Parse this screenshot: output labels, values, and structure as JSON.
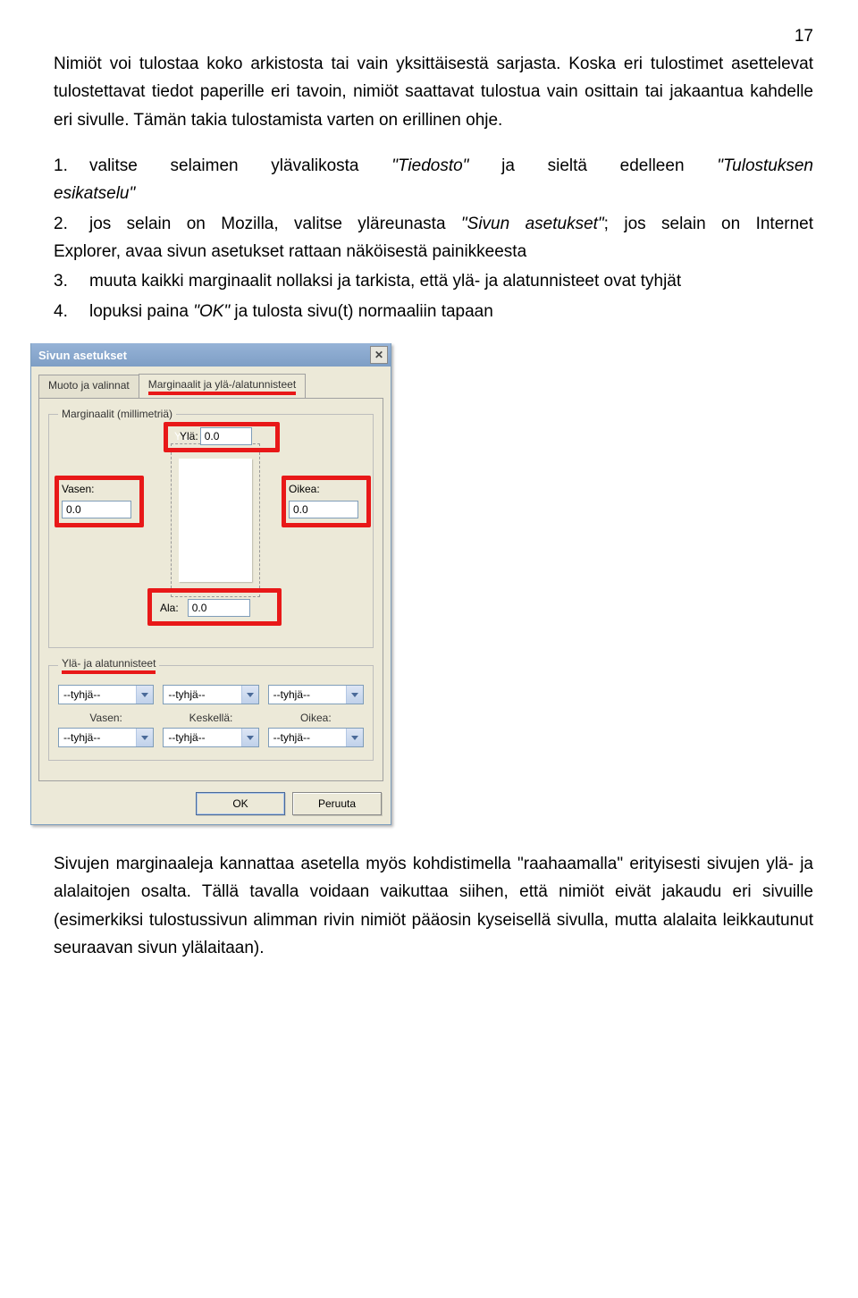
{
  "page_number": "17",
  "para1": "Nimiöt voi tulostaa koko arkistosta tai vain yksittäisestä sarjasta. Koska eri tulostimet asettelevat tulostettavat tiedot paperille eri tavoin, nimiöt saattavat tulostua vain osittain tai jakaantua kahdelle eri sivulle. Tämän takia tulostamista varten on erillinen ohje.",
  "list": {
    "i1": {
      "n": "1.",
      "a": "valitse  selaimen  ylävalikosta ",
      "b": "\"Tiedosto\"",
      "c": "  ja  sieltä  edelleen ",
      "d": "\"Tulostuksen",
      "tail": "esikatselu\""
    },
    "i2": {
      "n": "2.",
      "a": "jos selain on Mozilla, valitse yläreunasta ",
      "b": "\"Sivun asetukset\"",
      "c": "; jos selain on Internet",
      "tail": "Explorer, avaa sivun asetukset rattaan näköisestä painikkeesta"
    },
    "i3": {
      "n": "3.",
      "a": "muuta kaikki marginaalit nollaksi ja tarkista, että ylä- ja alatunnisteet ovat tyhjät"
    },
    "i4": {
      "n": "4.",
      "a": "lopuksi paina ",
      "b": "\"OK\"",
      "c": " ja tulosta sivu(t) normaaliin tapaan"
    }
  },
  "dialog": {
    "title": "Sivun asetukset",
    "tab_inactive": "Muoto ja valinnat",
    "tab_active": "Marginaalit ja ylä-/alatunnisteet",
    "margins_legend": "Marginaalit (millimetriä)",
    "top_label": "Ylä:",
    "top_value": "0.0",
    "left_label": "Vasen:",
    "left_value": "0.0",
    "right_label": "Oikea:",
    "right_value": "0.0",
    "bottom_label": "Ala:",
    "bottom_value": "0.0",
    "hf_legend": "Ylä- ja alatunnisteet",
    "opt": "--tyhjä--",
    "col_left": "Vasen:",
    "col_center": "Keskellä:",
    "col_right": "Oikea:",
    "ok": "OK",
    "cancel": "Peruuta"
  },
  "para2": "Sivujen marginaaleja kannattaa asetella myös kohdistimella \"raahaamalla\" erityisesti sivujen ylä- ja alalaitojen osalta. Tällä tavalla voidaan vaikuttaa siihen, että nimiöt eivät jakaudu eri sivuille (esimerkiksi tulostussivun alimman rivin nimiöt pääosin kyseisellä sivulla, mutta alalaita leikkautunut seuraavan sivun ylälaitaan)."
}
